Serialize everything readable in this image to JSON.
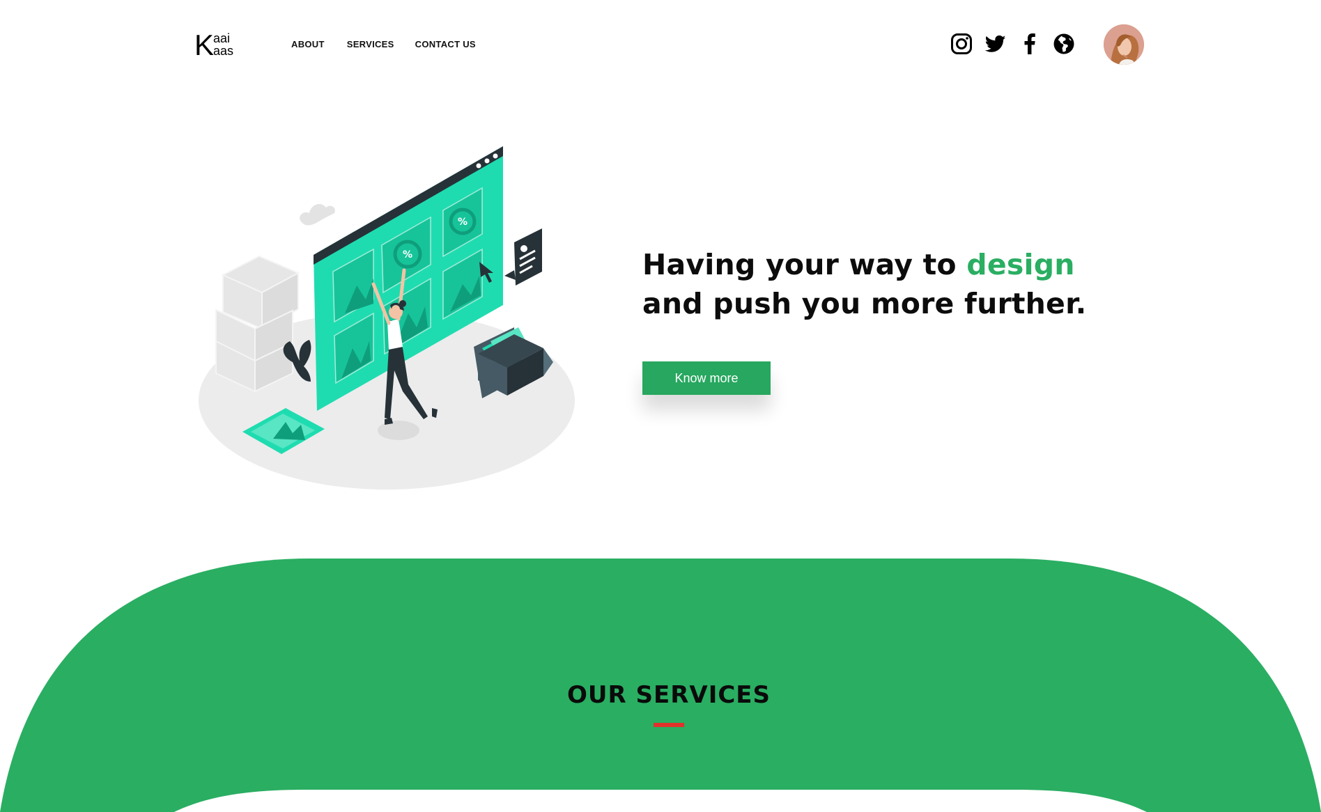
{
  "logo": {
    "letter": "K",
    "top": "aai",
    "bottom": "aas"
  },
  "nav": {
    "items": [
      "ABOUT",
      "SERVICES",
      "CONTACT US"
    ]
  },
  "social": {
    "icons": [
      "instagram-icon",
      "twitter-icon",
      "facebook-icon",
      "globe-icon"
    ]
  },
  "hero": {
    "title_before": "Having your way to ",
    "title_accent": "design",
    "title_after": " and push you more further.",
    "cta_label": "Know more"
  },
  "services": {
    "title": "OUR SERVICES"
  },
  "colors": {
    "accent": "#2aae62",
    "band": "#2aae62",
    "illustration_teal": "#1fdcb0",
    "underline": "#e1322a"
  }
}
